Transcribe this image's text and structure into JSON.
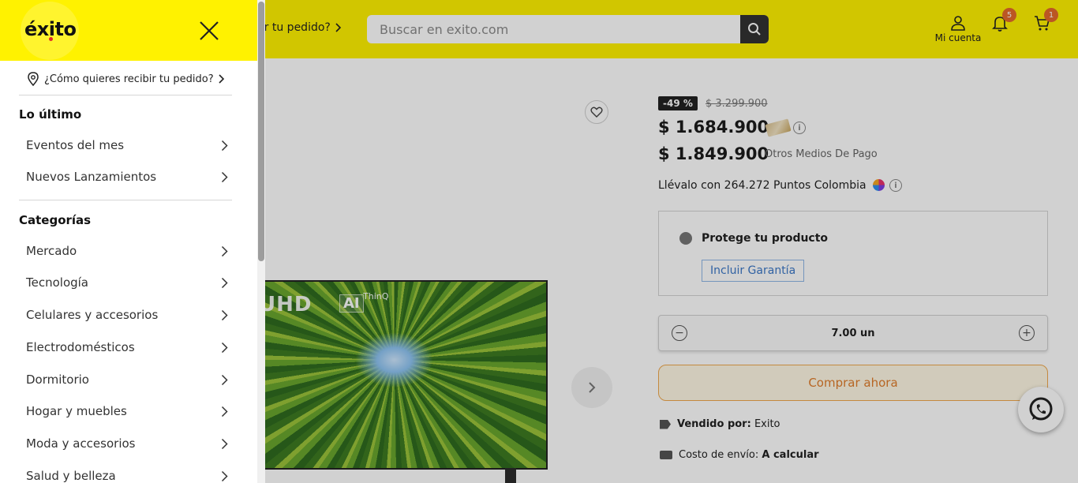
{
  "header": {
    "delivery_prompt": "ibir tu pedido?",
    "search": {
      "placeholder": "Buscar en exito.com"
    },
    "account_label": "Mi cuenta",
    "notifications_count": "5",
    "cart_count": "1"
  },
  "product": {
    "discount": "-49 %",
    "old_price": "$ 3.299.900",
    "price_card": "$ 1.684.900",
    "price_other": "$ 1.849.900",
    "price_other_label": "Otros Medios De Pago",
    "points_prefix": "Llévalo con",
    "points_value": "264.272",
    "points_suffix": "Puntos Colombia",
    "protect_title": "Protege tu producto",
    "warranty_button": "Incluir Garantía",
    "quantity": "7.00 un",
    "buy_button": "Comprar ahora",
    "seller_label": "Vendido por:",
    "seller_name": "Exito",
    "shipping_label": "Costo de envío:",
    "shipping_value": "A calcular",
    "tv_brand": "UHD",
    "tv_ai": "AI",
    "tv_thinq": "ThinQ"
  },
  "drawer": {
    "logo": "éxito",
    "delivery": "¿Cómo quieres recibir tu pedido?",
    "sections": [
      {
        "title": "Lo último",
        "items": [
          "Eventos del mes",
          "Nuevos Lanzamientos"
        ]
      },
      {
        "title": "Categorías",
        "items": [
          "Mercado",
          "Tecnología",
          "Celulares y accesorios",
          "Electrodomésticos",
          "Dormitorio",
          "Hogar y muebles",
          "Moda y accesorios",
          "Salud y belleza"
        ]
      }
    ]
  },
  "colors": {
    "brand_yellow": "#fff200",
    "badge_orange": "#e56a2b",
    "buy_orange": "#e07d2c",
    "link_blue": "#3c78c7"
  }
}
